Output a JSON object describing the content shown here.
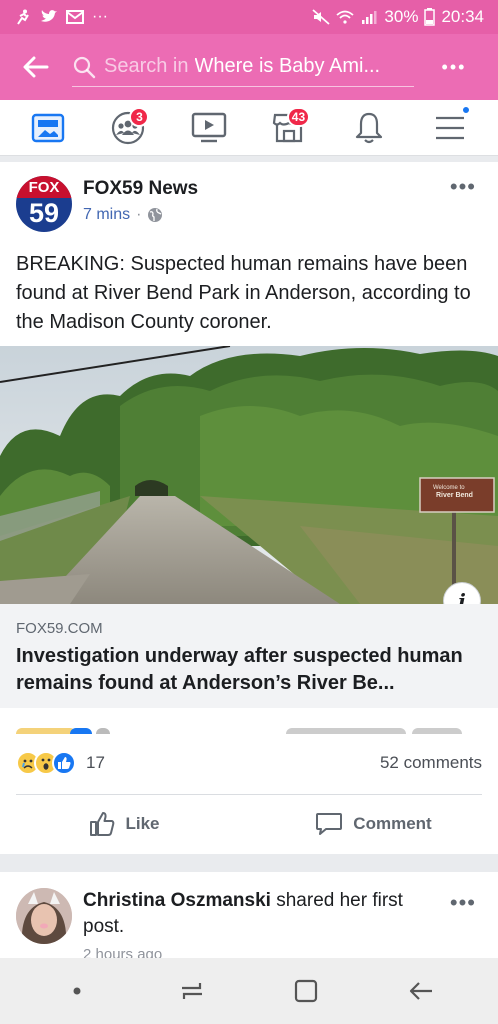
{
  "status_bar": {
    "battery": "30%",
    "time": "20:34",
    "overflow": "···"
  },
  "header": {
    "search_placeholder": "Search in",
    "search_query": "Where is Baby Ami...",
    "more": "•••"
  },
  "nav": {
    "items": [
      {
        "name": "news-feed",
        "badge": ""
      },
      {
        "name": "groups",
        "badge": "3"
      },
      {
        "name": "watch",
        "badge": ""
      },
      {
        "name": "marketplace",
        "badge": "43"
      },
      {
        "name": "notifications",
        "badge": ""
      },
      {
        "name": "menu",
        "badge": ""
      }
    ]
  },
  "post": {
    "avatar_top": "FOX",
    "avatar_bottom": "59",
    "page_name": "FOX59 News",
    "time": "7 mins",
    "sep": "·",
    "more": "•••",
    "text": "BREAKING: Suspected human remains have been found at River Bend Park in Anderson, according to the Madison County coroner.",
    "sign_text_1": "Welcome to",
    "sign_text_2": "River Bend",
    "link_domain": "FOX59.COM",
    "link_title": "Investigation underway after suspected human remains found at Anderson’s River Be...",
    "info_glyph": "i",
    "reaction_count": "17",
    "comment_count": "52 comments",
    "like_label": "Like",
    "comment_label": "Comment"
  },
  "post2": {
    "author": "Christina Oszmanski",
    "action": " shared her first post.",
    "meta": "2 hours ago",
    "more": "•••"
  },
  "colors": {
    "header_pink": "#ec6cb4",
    "status_pink": "#e65fa8",
    "facebook_blue": "#1877f2",
    "badge_red": "#f02849"
  }
}
